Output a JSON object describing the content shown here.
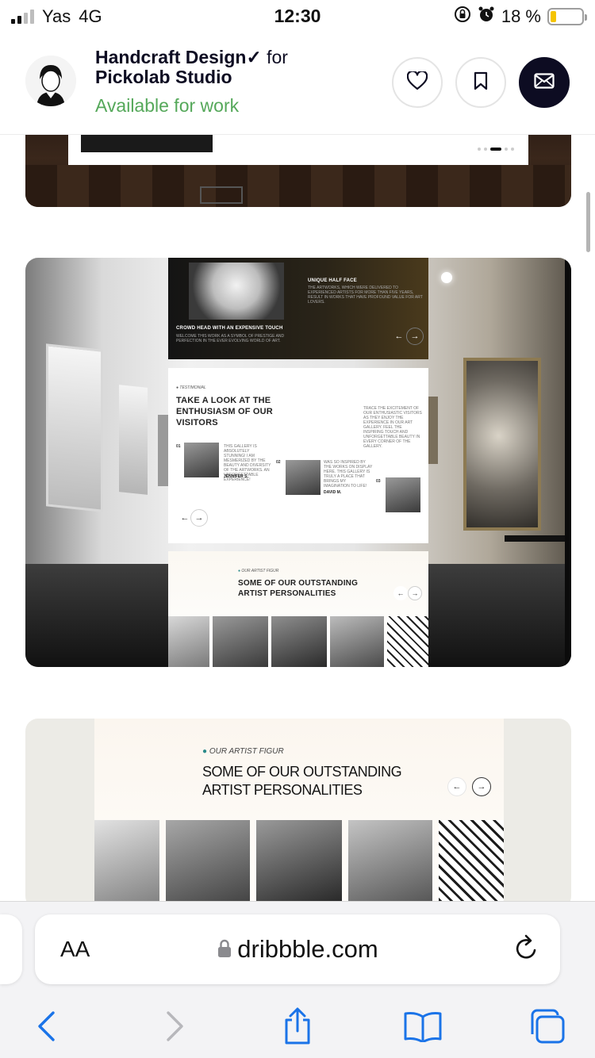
{
  "status_bar": {
    "carrier": "Yas",
    "network": "4G",
    "time": "12:30",
    "battery": "18 %",
    "battery_level": 0.18,
    "icons": [
      "signal-icon",
      "rotation-lock-icon",
      "alarm-icon",
      "battery-icon"
    ]
  },
  "profile": {
    "shot_title": "Handcraft Design",
    "connector": "for",
    "team": "Pickolab Studio",
    "availability": "Available for work",
    "availability_color": "#55a85a",
    "buttons": [
      "heart-icon",
      "bookmark-icon",
      "mail-icon"
    ]
  },
  "shots": {
    "museum": {
      "cards": [
        {
          "title": "CROWD HEAD WITH AN EXPENSIVE TOUCH",
          "body": "WELCOME THIS WORK AS A SYMBOL OF PRESTIGE AND PERFECTION IN THE EVER EVOLVING WORLD OF ART."
        },
        {
          "title": "UNIQUE HALF FACE",
          "body": "THE ARTWORKS, WHICH WERE DELIVERED TO EXPERIENCED ARTISTS FOR MORE THAN FIVE YEARS, RESULT IN WORKS THAT HAVE PROFOUND VALUE FOR ART LOVERS."
        }
      ],
      "testimonial": {
        "tag": "TESTIMONIAL",
        "heading_1": "TAKE A LOOK AT THE",
        "heading_2": "ENTHUSIASM OF OUR",
        "heading_3": "VISITORS",
        "side_text": "TRACE THE EXCITEMENT OF OUR ENTHUSIASTIC VISITORS AS THEY ENJOY THE EXPERIENCE IN OUR ART GALLERY. FEEL THE INSPIRING TOUCH AND UNFORGETTABLE BEAUTY IN EVERY CORNER OF THE GALLERY.",
        "items": [
          {
            "num": "01",
            "quote": "THIS GALLERY IS ABSOLUTELY STUNNING! I AM MESMERIZED BY THE BEAUTY AND DIVERSITY OF THE ARTWORKS. AN UNFORGETTABLE EXPERIENCE!",
            "name": "JENNIFER S."
          },
          {
            "num": "02",
            "quote": "WAS SO INSPIRED BY THE WORKS ON DISPLAY HERE. THIS GALLERY IS TRULY A PLACE THAT BRINGS MY IMAGINATION TO LIFE!",
            "name": "DAVID M."
          },
          {
            "num": "03",
            "quote": "",
            "name": ""
          }
        ]
      },
      "artists": {
        "tag": "OUR ARTIST FIGUR",
        "heading_1": "SOME OF OUR OUTSTANDING",
        "heading_2": "ARTIST PERSONALITIES"
      }
    },
    "artists_panel": {
      "tag": "OUR ARTIST FIGUR",
      "heading_1": "SOME OF OUR OUTSTANDING",
      "heading_2": "ARTIST PERSONALITIES"
    }
  },
  "browser": {
    "text_size_label": "AA",
    "url": "dribbble.com",
    "lock_icon": "lock-icon",
    "reload_icon": "reload-icon",
    "toolbar": [
      "back-icon",
      "forward-icon",
      "share-icon",
      "bookmarks-icon",
      "tabs-icon"
    ],
    "accent": "#1a73e8"
  }
}
